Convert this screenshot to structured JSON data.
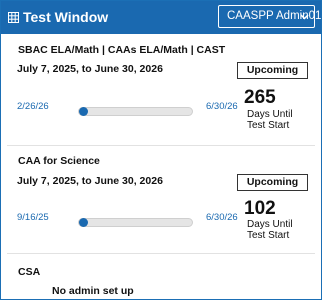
{
  "header": {
    "title": "Test Window",
    "admin_select_value": "CAASPP Admin01"
  },
  "sections": [
    {
      "title": "SBAC ELA/Math | CAAs ELA/Math | CAST",
      "range": "July 7, 2025, to June 30, 2026",
      "status": "Upcoming",
      "start_label": "2/26/26",
      "end_label": "6/30/26",
      "progress_fraction": 0,
      "days": "265",
      "days_label_1": "Days Until",
      "days_label_2": "Test Start"
    },
    {
      "title": "CAA for Science",
      "range": "July 7, 2025, to June 30, 2026",
      "status": "Upcoming",
      "start_label": "9/16/25",
      "end_label": "6/30/26",
      "progress_fraction": 0,
      "days": "102",
      "days_label_1": "Days Until",
      "days_label_2": "Test Start"
    },
    {
      "title": "CSA",
      "message": "No admin set up"
    }
  ],
  "colors": {
    "header_bg": "#1a69b0",
    "accent": "#1a69b0",
    "track": "#e5e5e5"
  },
  "icons": {
    "header": "grid-calendar-icon",
    "select": "chevron-down-icon"
  }
}
